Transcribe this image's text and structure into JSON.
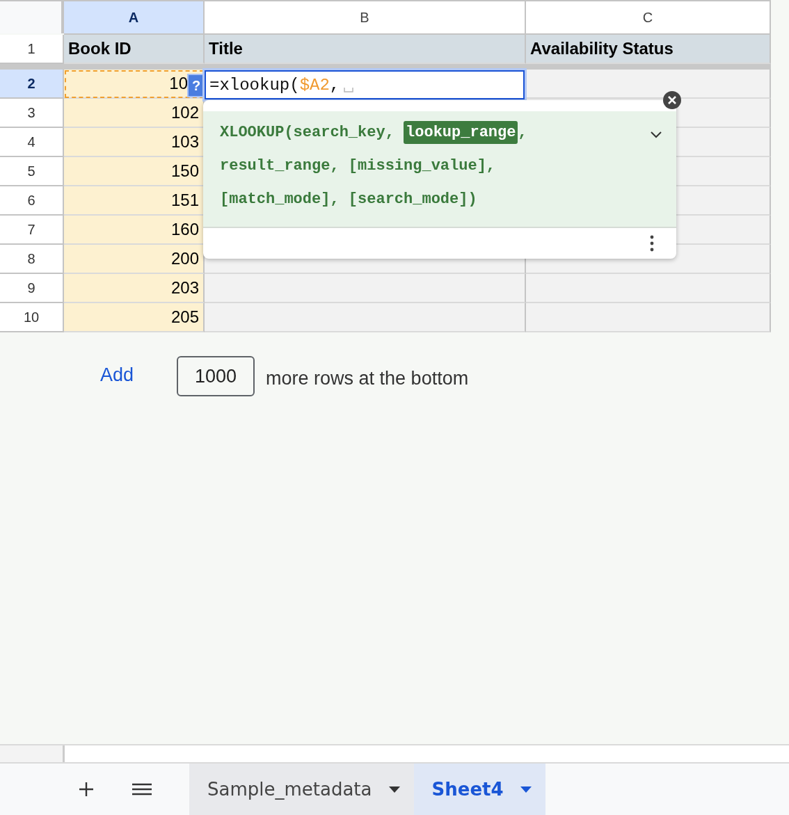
{
  "columns": [
    {
      "label": "A",
      "selected": true
    },
    {
      "label": "B",
      "selected": false
    },
    {
      "label": "C",
      "selected": false
    }
  ],
  "rows": [
    {
      "number": "1",
      "selected": false,
      "kind": "header",
      "cells": [
        "Book ID",
        "Title",
        "Availability Status"
      ]
    },
    {
      "number": "2",
      "selected": true,
      "kind": "data",
      "cells": [
        "10"
      ]
    },
    {
      "number": "3",
      "selected": false,
      "kind": "data",
      "cells": [
        "102"
      ]
    },
    {
      "number": "4",
      "selected": false,
      "kind": "data",
      "cells": [
        "103"
      ]
    },
    {
      "number": "5",
      "selected": false,
      "kind": "data",
      "cells": [
        "150"
      ]
    },
    {
      "number": "6",
      "selected": false,
      "kind": "data",
      "cells": [
        "151"
      ]
    },
    {
      "number": "7",
      "selected": false,
      "kind": "data",
      "cells": [
        "160"
      ]
    },
    {
      "number": "8",
      "selected": false,
      "kind": "data",
      "cells": [
        "200"
      ]
    },
    {
      "number": "9",
      "selected": false,
      "kind": "data",
      "cells": [
        "203"
      ]
    },
    {
      "number": "10",
      "selected": false,
      "kind": "data",
      "cells": [
        "205"
      ]
    }
  ],
  "editor": {
    "help_badge": "?",
    "parts": [
      {
        "text": "=xlookup(",
        "kind": "plain"
      },
      {
        "text": "$A2",
        "kind": "reference"
      },
      {
        "text": ",",
        "kind": "plain"
      }
    ]
  },
  "formula_help": {
    "lines": [
      [
        {
          "text": "XLOOKUP(search_key, ",
          "current": false
        },
        {
          "text": "lookup_range",
          "current": true
        },
        {
          "text": ",",
          "current": false
        }
      ],
      [
        {
          "text": "result_range, [missing_value],",
          "current": false
        }
      ],
      [
        {
          "text": "[match_mode], [search_mode])",
          "current": false
        }
      ]
    ]
  },
  "add_rows": {
    "button": "Add",
    "value": "1000",
    "label": "more rows at the bottom"
  },
  "sheet_tabs": [
    {
      "label": "Sample_metadata",
      "selected": false
    },
    {
      "label": "Sheet4",
      "selected": true
    }
  ]
}
